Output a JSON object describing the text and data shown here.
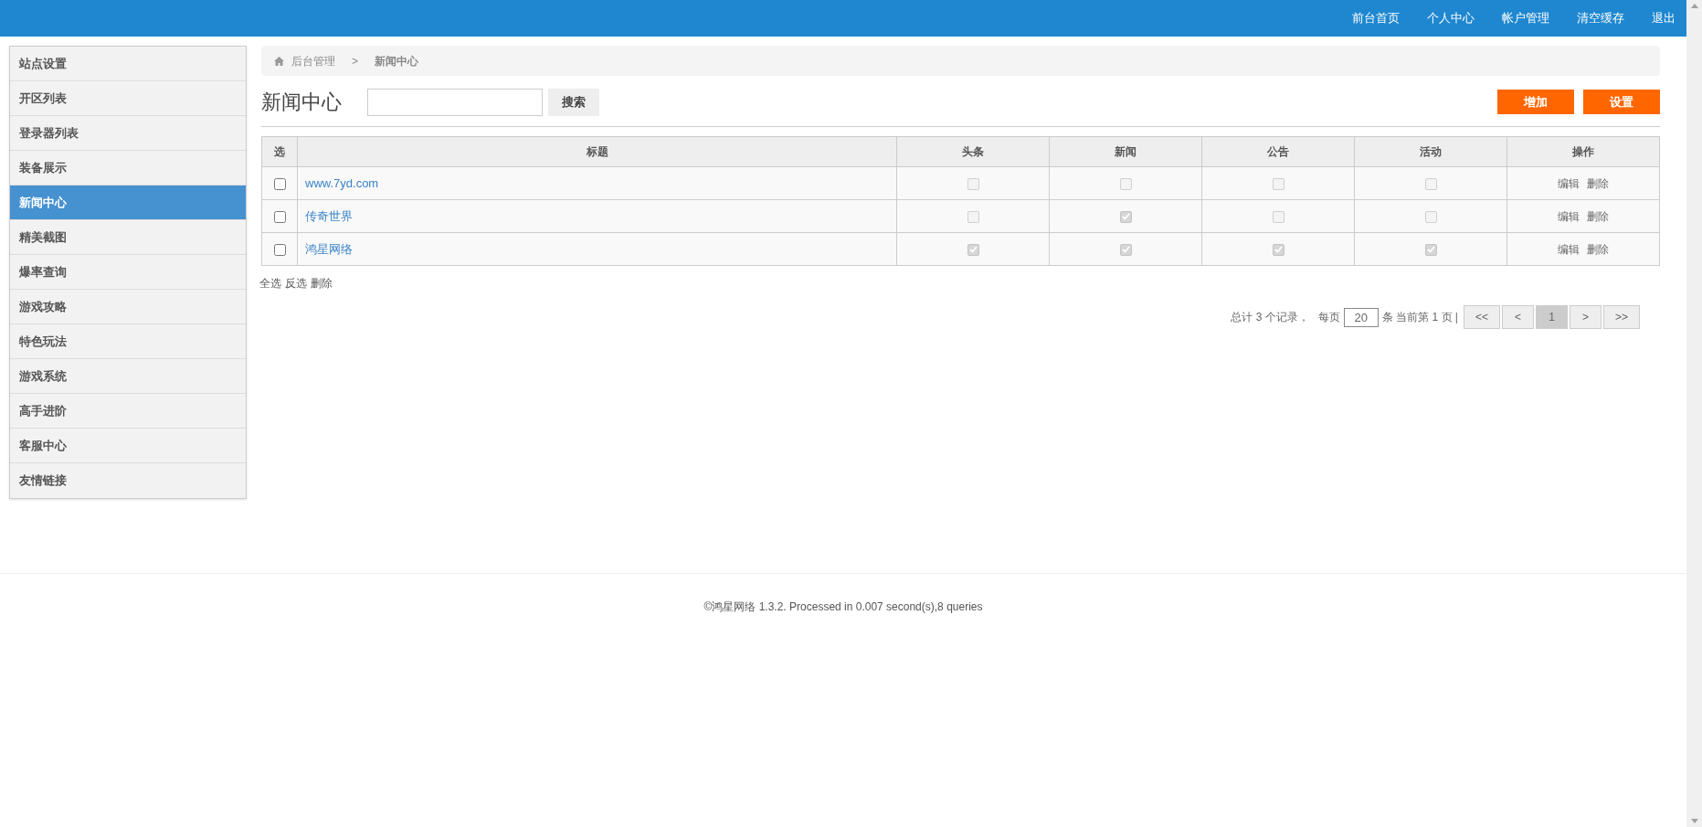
{
  "top_nav": [
    "前台首页",
    "个人中心",
    "帐户管理",
    "清空缓存",
    "退出"
  ],
  "sidebar": {
    "items": [
      {
        "label": "站点设置",
        "selected": false
      },
      {
        "label": "开区列表",
        "selected": false
      },
      {
        "label": "登录器列表",
        "selected": false
      },
      {
        "label": "装备展示",
        "selected": false
      },
      {
        "label": "新闻中心",
        "selected": true
      },
      {
        "label": "精美截图",
        "selected": false
      },
      {
        "label": "爆率查询",
        "selected": false
      },
      {
        "label": "游戏攻略",
        "selected": false
      },
      {
        "label": "特色玩法",
        "selected": false
      },
      {
        "label": "游戏系统",
        "selected": false
      },
      {
        "label": "高手进阶",
        "selected": false
      },
      {
        "label": "客服中心",
        "selected": false
      },
      {
        "label": "友情链接",
        "selected": false
      }
    ]
  },
  "breadcrumb": [
    "后台管理",
    ">",
    "新闻中心"
  ],
  "page_title": "新闻中心",
  "search": {
    "button": "搜索"
  },
  "actions": [
    "增加",
    "设置"
  ],
  "table": {
    "columns": [
      "选",
      "标题",
      "头条",
      "新闻",
      "公告",
      "活动",
      "操作"
    ],
    "rows": [
      {
        "selected": false,
        "title": "www.7yd.com",
        "flags": [
          false,
          false,
          false,
          false
        ],
        "ops": [
          "编辑",
          "删除"
        ]
      },
      {
        "selected": false,
        "title": "传奇世界",
        "flags": [
          false,
          true,
          false,
          false
        ],
        "ops": [
          "编辑",
          "删除"
        ]
      },
      {
        "selected": false,
        "title": "鸿星网络",
        "flags": [
          true,
          true,
          true,
          true
        ],
        "ops": [
          "编辑",
          "删除"
        ]
      }
    ]
  },
  "bulk_actions": [
    "全选",
    "反选",
    "删除"
  ],
  "pagination": {
    "summary": "总计 3 个记录，",
    "per_page_label": "每页",
    "per_page": "20",
    "page_info": "条 当前第 1 页 |",
    "buttons": [
      {
        "label": "<<",
        "selected": false
      },
      {
        "label": "<",
        "selected": false
      },
      {
        "label": "1",
        "selected": true
      },
      {
        "label": ">",
        "selected": false
      },
      {
        "label": ">>",
        "selected": false
      }
    ]
  },
  "footer": "©鸿星网络 1.3.2. Processed in 0.007 second(s),8 queries"
}
